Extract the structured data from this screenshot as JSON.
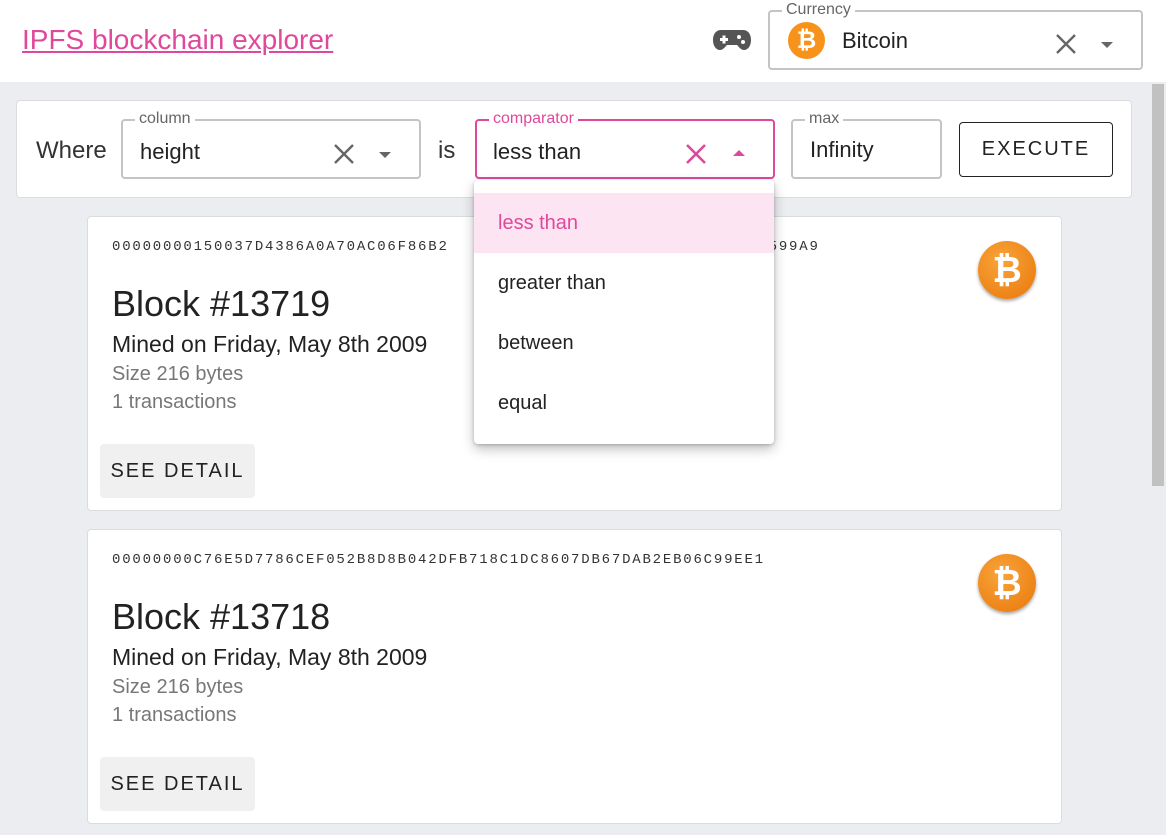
{
  "header": {
    "title": "IPFS blockchain explorer",
    "gamepad_icon": "gamepad-icon",
    "currency": {
      "label": "Currency",
      "value": "Bitcoin",
      "icon": "bitcoin-icon",
      "icon_glyph": "₿",
      "accent_color": "#f7931a"
    }
  },
  "filter": {
    "where_label": "Where",
    "is_label": "is",
    "column": {
      "label": "column",
      "value": "height"
    },
    "comparator": {
      "label": "comparator",
      "value": "less than",
      "focused": true
    },
    "max": {
      "label": "max",
      "value": "Infinity"
    },
    "execute_label": "EXECUTE",
    "accent_color": "#e0489b"
  },
  "comparator_menu": {
    "options": [
      {
        "label": "less than",
        "selected": true
      },
      {
        "label": "greater than",
        "selected": false
      },
      {
        "label": "between",
        "selected": false
      },
      {
        "label": "equal",
        "selected": false
      }
    ]
  },
  "blocks": [
    {
      "hash_left": "00000000150037D4386A0A70AC06F86B2",
      "hash_right": "599A9",
      "title": "Block #13719",
      "mined": "Mined on Friday, May 8th 2009",
      "size": "Size 216 bytes",
      "transactions": "1 transactions",
      "detail_label": "SEE DETAIL",
      "coin_glyph": "₿"
    },
    {
      "hash": "00000000C76E5D7786CEF052B8D8B042DFB718C1DC8607DB67DAB2EB06C99EE1",
      "title": "Block #13718",
      "mined": "Mined on Friday, May 8th 2009",
      "size": "Size 216 bytes",
      "transactions": "1 transactions",
      "detail_label": "SEE DETAIL",
      "coin_glyph": "₿"
    }
  ]
}
